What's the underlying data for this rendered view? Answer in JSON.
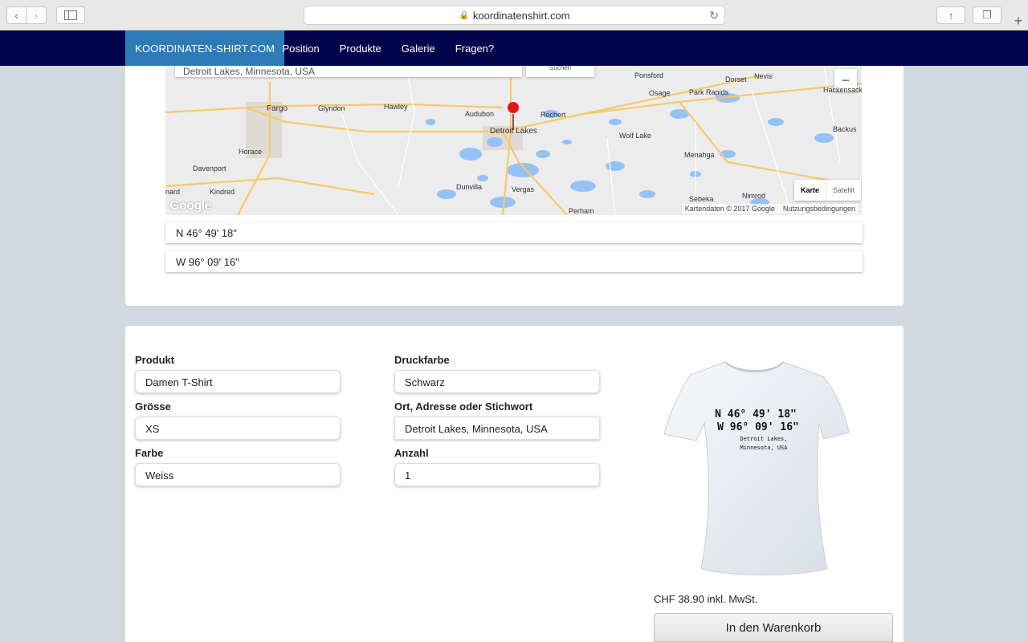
{
  "browser": {
    "url": "koordinatenshirt.com",
    "icons": [
      "back-icon",
      "forward-icon",
      "sidebar-icon",
      "lock-icon",
      "reload-icon",
      "share-icon",
      "tabs-icon",
      "new-tab-icon"
    ]
  },
  "nav": {
    "brand": "KOORDINATEN-SHIRT.COM",
    "links": [
      "Position",
      "Produkte",
      "Galerie",
      "Fragen?"
    ]
  },
  "map": {
    "search_value": "Detroit Lakes, Minnesota, USA",
    "search_button": "Suchen",
    "type_map": "Karte",
    "type_satellite": "Satellit",
    "credit": "Kartendaten © 2017 Google",
    "terms": "Nutzungsbedingungen",
    "logo": "Google",
    "zoom_out": "−",
    "places": [
      "Ponsford",
      "Dorset",
      "Nevis",
      "Hackensack",
      "Fargo",
      "Glyndon",
      "Hawley",
      "Audubon",
      "Rochert",
      "Osage",
      "Park Rapids",
      "Detroit Lakes",
      "Backus",
      "Wolf Lake",
      "Horace",
      "Menahga",
      "Davenport",
      "Kindred",
      "Dunvilla",
      "Vergas",
      "Sebeka",
      "Nimrod",
      "Perham",
      "nard"
    ]
  },
  "coords": {
    "lat": "N 46° 49' 18\"",
    "lon": "W 96° 09' 16\""
  },
  "form": {
    "produkt_label": "Produkt",
    "produkt_value": "Damen T-Shirt",
    "groesse_label": "Grösse",
    "groesse_value": "XS",
    "farbe_label": "Farbe",
    "farbe_value": "Weiss",
    "druckfarbe_label": "Druckfarbe",
    "druckfarbe_value": "Schwarz",
    "ort_label": "Ort, Adresse oder Stichwort",
    "ort_value": "Detroit Lakes, Minnesota, USA",
    "anzahl_label": "Anzahl",
    "anzahl_value": "1"
  },
  "shirt": {
    "line1": "N 46° 49' 18\"",
    "line2": "W 96° 09' 16\"",
    "line3": "Detroit Lakes,",
    "line4": "Minnesota, USA"
  },
  "price": "CHF 38.90 inkl. MwSt.",
  "cart_button": "In den Warenkorb",
  "colors": {
    "nav_bg": "#01044a",
    "brand_bg": "#2d7cb8",
    "page_bg": "#d3d9e0",
    "marker": "#e4161b",
    "water": "#94c2f4"
  }
}
